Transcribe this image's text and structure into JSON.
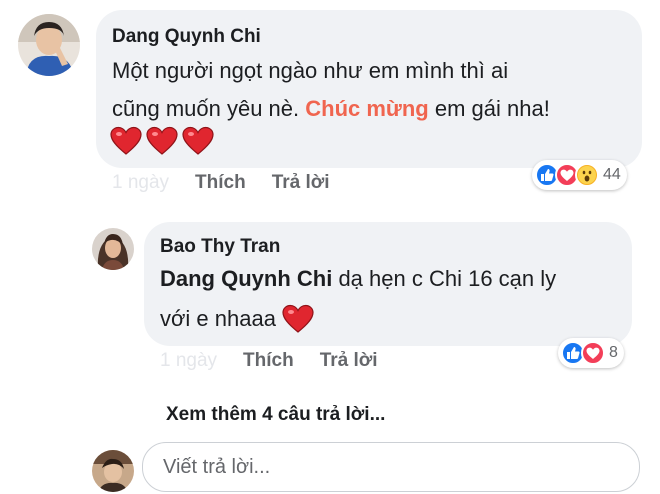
{
  "comment": {
    "author": "Dang Quynh Chi",
    "text_line1": "Một người ngọt ngào như em mình thì ai",
    "text_line2_before": "cũng muốn yêu nè. ",
    "text_line2_highlight": "Chúc mừng",
    "text_line2_after": " em gái nha!",
    "hearts": "❤️❤️❤️",
    "time": "1 ngày",
    "like_label": "Thích",
    "reply_label": "Trả lời",
    "reaction_count": "44",
    "reactions": [
      "like-icon",
      "love-icon",
      "wow-icon"
    ]
  },
  "reply": {
    "author": "Bao Thy Tran",
    "mention": "Dang Quynh Chi",
    "text_line1_after": " dạ hẹn c Chi 16 cạn ly",
    "text_line2": "với e nhaaa ",
    "time": "1 ngày",
    "like_label": "Thích",
    "reply_label": "Trả lời",
    "reaction_count": "8",
    "reactions": [
      "like-icon",
      "love-icon"
    ]
  },
  "view_more": "Xem thêm 4 câu trả lời...",
  "reply_input": {
    "placeholder": "Viết trả lời..."
  },
  "colors": {
    "bubble": "#f0f2f5",
    "highlight": "#f0654f",
    "like_blue": "#1877f2",
    "love_red": "#f33e58",
    "wow_yellow": "#f7b125"
  }
}
